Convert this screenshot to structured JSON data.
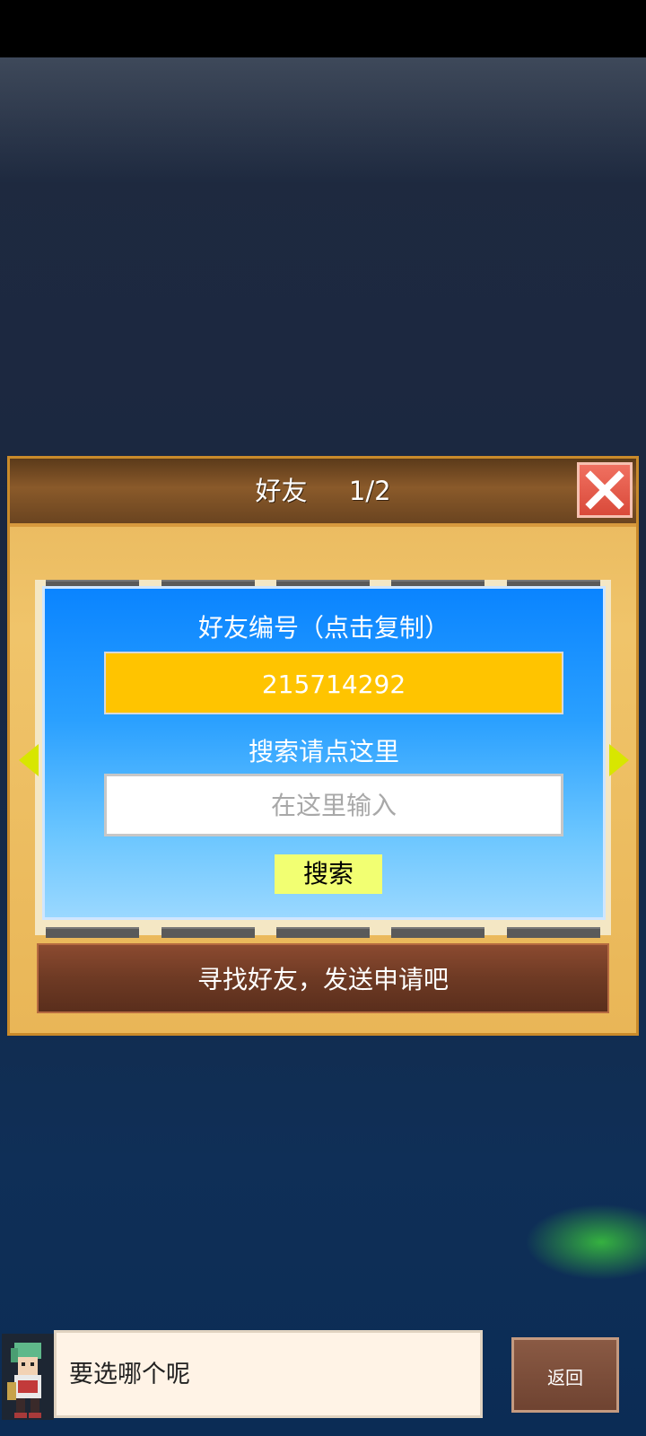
{
  "dialog": {
    "title": "好友",
    "page": "1/2",
    "friend_id_label": "好友编号（点击复制）",
    "friend_id": "215714292",
    "search_label": "搜索请点这里",
    "search_placeholder": "在这里输入",
    "search_button": "搜索",
    "info_text": "寻找好友，发送申请吧"
  },
  "bottom": {
    "message": "要选哪个呢",
    "back_button": "返回"
  },
  "icons": {
    "close": "close-icon",
    "prev": "arrow-left-icon",
    "next": "arrow-right-icon"
  },
  "colors": {
    "friend_id_bg": "#ffc400",
    "search_button_bg": "#f2ff72",
    "close_button": "#d94a3a",
    "arrow": "#d8e600"
  }
}
